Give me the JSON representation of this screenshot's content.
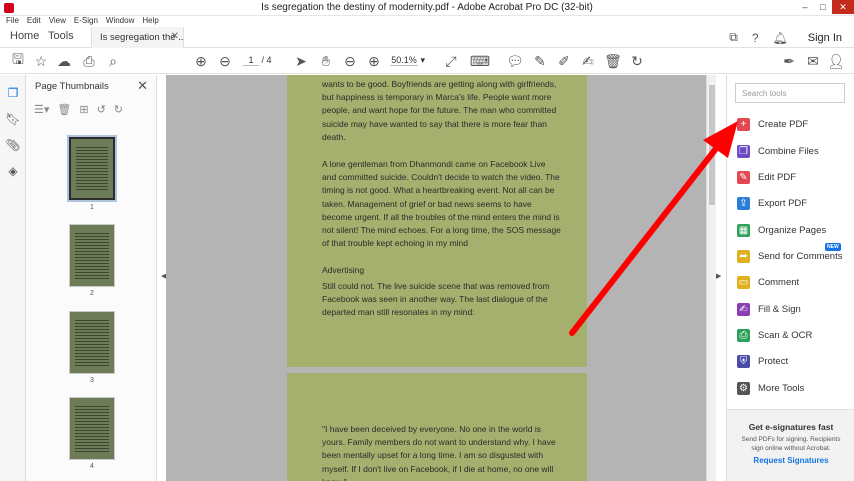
{
  "window": {
    "title": "Is segregation the destiny of modernity.pdf - Adobe Acrobat Pro DC (32-bit)",
    "controls": [
      "–",
      "□",
      "✕"
    ]
  },
  "menu": [
    "File",
    "Edit",
    "View",
    "E-Sign",
    "Window",
    "Help"
  ],
  "tabs": {
    "home": "Home",
    "tools": "Tools",
    "doc": "Is segregation the ...",
    "sign_in": "Sign In"
  },
  "toolbar": {
    "current_page": "1",
    "page_count": "/ 4",
    "zoom": "50.1%"
  },
  "thumbnails": {
    "title": "Page Thumbnails",
    "pages": [
      "1",
      "2",
      "3",
      "4"
    ]
  },
  "document": {
    "page1_paragraphs": [
      "wants to be good. Boyfriends are getting along with girlfriends, but happiness is temporary in Marca's life. People want more people, and want hope for the future. The man who committed suicide may have wanted to say that there is more fear than death.",
      "A lone gentleman from Dhanmondi came on Facebook Live and committed suicide. Couldn't decide to watch the video. The timing is not good. What a heartbreaking event. Not all can be taken. Management of grief or bad news seems to have become urgent. If all the troubles of the mind enters the mind is not silent! The mind echoes. For a long time, the SOS message of that trouble kept echoing in my mind",
      "Advertising",
      "Still could not. The live suicide scene that was removed from Facebook was seen in another way. The last dialogue of the departed man still resonates in my mind:"
    ],
    "page2_paragraph": "\"I have been deceived by everyone. No one in the world is yours. Family members do not want to understand why. I have been mentally upset for a long time. I am so disgusted with myself. If I don't live on Facebook, if I die at home, no one will know.\""
  },
  "tools_pane": {
    "search_placeholder": "Search tools",
    "items": [
      {
        "label": "Create PDF",
        "icon": "create-pdf-icon",
        "color": "#e34850"
      },
      {
        "label": "Combine Files",
        "icon": "combine-files-icon",
        "color": "#6d4bc4"
      },
      {
        "label": "Edit PDF",
        "icon": "edit-pdf-icon",
        "color": "#e34850"
      },
      {
        "label": "Export PDF",
        "icon": "export-pdf-icon",
        "color": "#2b7fd6"
      },
      {
        "label": "Organize Pages",
        "icon": "organize-pages-icon",
        "color": "#2ea05a"
      },
      {
        "label": "Send for Comments",
        "icon": "send-comments-icon",
        "color": "#e0b020"
      },
      {
        "label": "Comment",
        "icon": "comment-icon",
        "color": "#e0b020"
      },
      {
        "label": "Fill & Sign",
        "icon": "fill-sign-icon",
        "color": "#8a3fb4"
      },
      {
        "label": "Scan & OCR",
        "icon": "scan-ocr-icon",
        "color": "#2ea05a"
      },
      {
        "label": "Protect",
        "icon": "protect-icon",
        "color": "#4a4aa8"
      },
      {
        "label": "More Tools",
        "icon": "more-tools-icon",
        "color": "#555555"
      }
    ],
    "new_badge": "NEW",
    "promo": {
      "title": "Get e-signatures fast",
      "body": "Send PDFs for signing. Recipients sign online without Acrobat.",
      "link": "Request Signatures"
    }
  },
  "colors": {
    "accent": "#1473e6",
    "page_tint": "#a6b06e",
    "arrow": "#ff0000"
  }
}
